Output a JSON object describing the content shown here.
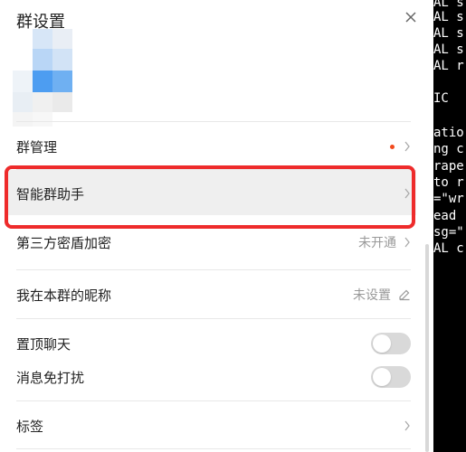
{
  "panel": {
    "title": "群设置",
    "close_icon": "close-icon"
  },
  "rows": {
    "group_manage": {
      "label": "群管理",
      "badge_color": "#f24a1d"
    },
    "smart_assistant": {
      "label": "智能群助手"
    },
    "third_party": {
      "label": "第三方密盾加密",
      "value": "未开通"
    },
    "nickname": {
      "label": "我在本群的昵称",
      "value": "未设置"
    },
    "pin_chat": {
      "label": "置顶聊天",
      "toggle_on": false
    },
    "mute": {
      "label": "消息免打扰",
      "toggle_on": false
    },
    "tags": {
      "label": "标签"
    }
  },
  "terminal_lines": [
    "AL s",
    "AL s",
    "AL s",
    "AL s",
    "AL r",
    "",
    "IC",
    "",
    "atio",
    "ng c",
    "rape",
    "to r",
    "=\"wr",
    "ead",
    "sg=\"",
    "AL c"
  ],
  "colors": {
    "highlight_border": "#ee2b2b",
    "badge": "#f24a1d"
  }
}
